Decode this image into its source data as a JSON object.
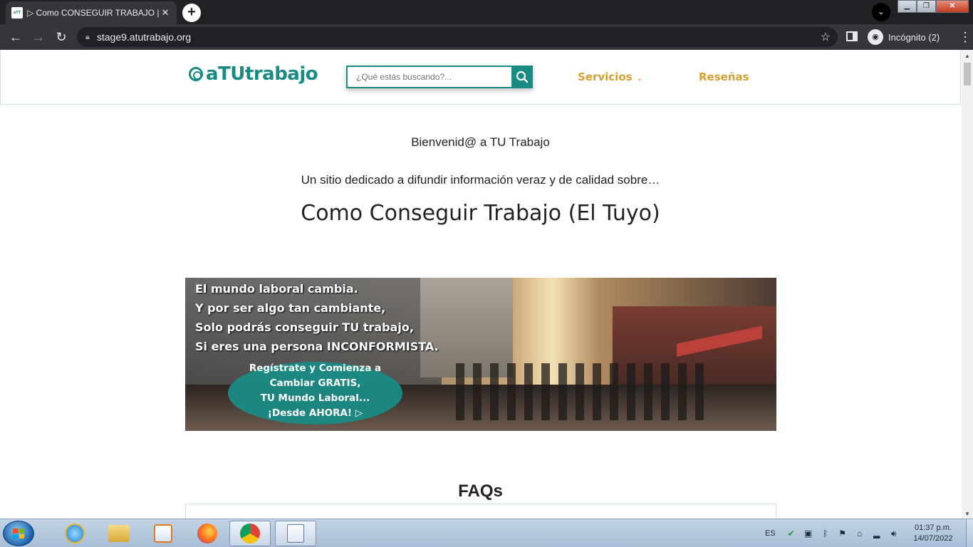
{
  "browser": {
    "tab_title": "▷ Como CONSEGUIR TRABAJO |",
    "favicon_text": "aTT",
    "url": "stage9.atutrabajo.org",
    "profile_label": "Incógnito (2)"
  },
  "site": {
    "logo_text": "aTUtrabajo",
    "search_placeholder": "¿Qué estás buscando?...",
    "nav": {
      "servicios": "Servicios",
      "resenas": "Reseñas"
    }
  },
  "hero": {
    "welcome": "Bienvenid@ a TU Trabajo",
    "subtitle": "Un sitio dedicado a difundir información veraz y de calidad sobre…",
    "heading": "Como Conseguir Trabajo (El Tuyo)"
  },
  "banner": {
    "lines": [
      "El mundo laboral cambia.",
      "Y por ser algo tan cambiante,",
      "Solo podrás conseguir TU trabajo,",
      "Si eres una persona INCONFORMISTA."
    ],
    "cta_lines": [
      "Regístrate y Comienza a",
      "Cambiar GRATIS,",
      "TU Mundo Laboral...",
      "¡Desde AHORA! ▷"
    ]
  },
  "faq": {
    "title": "FAQs"
  },
  "taskbar": {
    "language": "ES",
    "time": "01:37 p.m.",
    "date": "14/07/2022"
  },
  "colors": {
    "brand_teal": "#1a8a85",
    "nav_gold": "#d4a030"
  }
}
